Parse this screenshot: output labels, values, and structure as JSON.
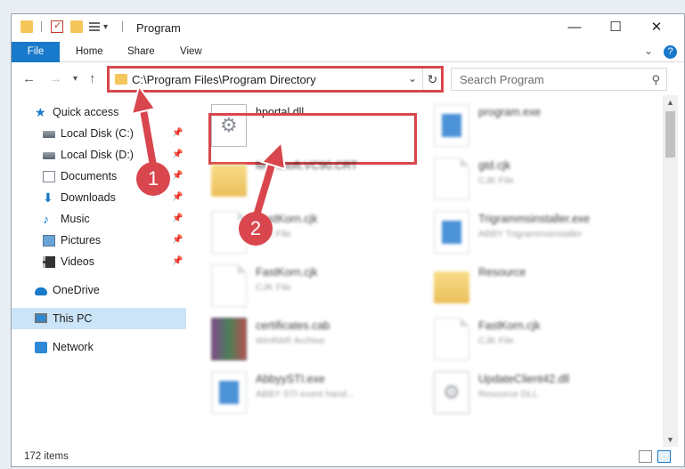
{
  "window": {
    "title": "Program"
  },
  "ribbon": {
    "tabs": [
      "File",
      "Home",
      "Share",
      "View"
    ],
    "help": "?"
  },
  "address": {
    "path": "C:\\Program Files\\Program Directory"
  },
  "search": {
    "placeholder": "Search Program"
  },
  "sidebar": {
    "items": [
      {
        "label": "Quick access",
        "icon": "star-icon"
      },
      {
        "label": "Local Disk (C:)",
        "icon": "drive-icon",
        "pinned": true
      },
      {
        "label": "Local Disk (D:)",
        "icon": "drive-icon",
        "pinned": true
      },
      {
        "label": "Documents",
        "icon": "documents-icon",
        "pinned": true
      },
      {
        "label": "Downloads",
        "icon": "download-icon",
        "pinned": true
      },
      {
        "label": "Music",
        "icon": "music-icon",
        "pinned": true
      },
      {
        "label": "Pictures",
        "icon": "pictures-icon",
        "pinned": true
      },
      {
        "label": "Videos",
        "icon": "videos-icon",
        "pinned": true
      },
      {
        "label": "OneDrive",
        "icon": "cloud-icon"
      },
      {
        "label": "This PC",
        "icon": "computer-icon",
        "selected": true
      },
      {
        "label": "Network",
        "icon": "network-icon"
      }
    ]
  },
  "files": [
    {
      "name": "hportal.dll",
      "sub": "",
      "icon": "gear-file-icon"
    },
    {
      "name": "program.exe",
      "sub": "",
      "icon": "app-icon"
    },
    {
      "name": "Microsoft.VC90.CRT",
      "sub": "",
      "icon": "folder-icon"
    },
    {
      "name": "gtd.cjk",
      "sub": "CJK File",
      "icon": "file-icon"
    },
    {
      "name": "FastKorn.cjk",
      "sub": "CJK File",
      "icon": "file-icon"
    },
    {
      "name": "Trigrammsinstaller.exe",
      "sub": "ABBY Trigrammsinstaller",
      "icon": "app-icon"
    },
    {
      "name": "FastKorn.cjk",
      "sub": "CJK File",
      "icon": "file-icon"
    },
    {
      "name": "Resource",
      "sub": "",
      "icon": "folder-icon"
    },
    {
      "name": "certificates.cab",
      "sub": "WinRAR Archive",
      "icon": "archive-icon"
    },
    {
      "name": "FastKorn.cjk",
      "sub": "CJK File",
      "icon": "file-icon"
    },
    {
      "name": "AbbyySTI.exe",
      "sub": "ABBY STI event hand...",
      "icon": "app-icon"
    },
    {
      "name": "UpdateClient42.dll",
      "sub": "Resource DLL",
      "icon": "gear-file-icon"
    }
  ],
  "status": {
    "item_count": "172 items"
  },
  "annotations": {
    "step1": "1",
    "step2": "2"
  },
  "colors": {
    "accent": "#1979ca",
    "highlight": "#d9464d",
    "selected": "#cce4f7"
  }
}
